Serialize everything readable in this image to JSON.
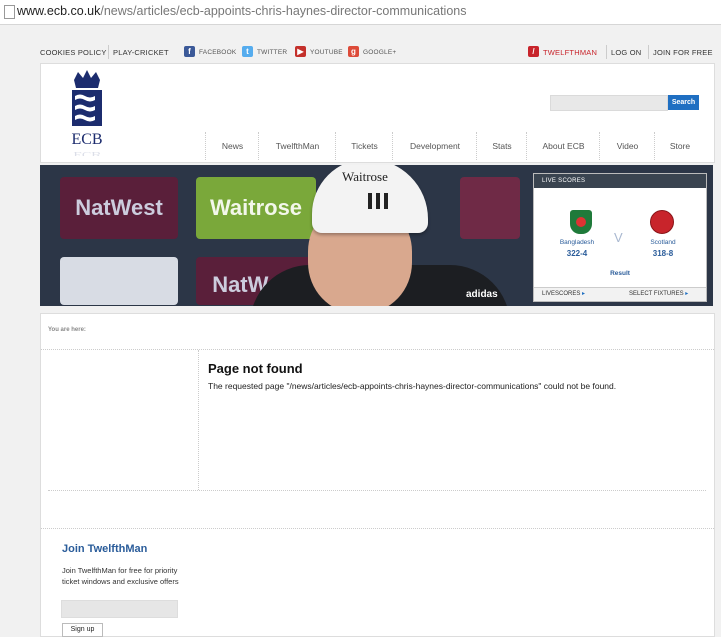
{
  "browser": {
    "url_domain": "www.ecb.co.uk",
    "url_path": "/news/articles/ecb-appoints-chris-haynes-director-communications"
  },
  "top_bar": {
    "cookies_policy": "COOKIES POLICY",
    "play_cricket": "PLAY-CRICKET",
    "facebook": "FACEBOOK",
    "twitter": "TWITTER",
    "youtube": "YOUTUBE",
    "googleplus": "GOOGLE+",
    "twelfthman": "TWELFTHMAN",
    "log_on": "LOG ON",
    "join": "JOIN FOR FREE"
  },
  "header": {
    "logo_text": "ECB",
    "search_button": "Search"
  },
  "nav": [
    "News",
    "TwelfthMan",
    "Tickets",
    "Development",
    "Stats",
    "About ECB",
    "Video",
    "Store"
  ],
  "banner": {
    "cap_brand": "Waitrose",
    "boards": [
      "NatWest",
      "Waitrose",
      "NatWest"
    ],
    "kit_brand": "adidas"
  },
  "live_scores": {
    "title": "LIVE SCORES",
    "vs": "V",
    "team1": {
      "name": "Bangladesh",
      "score": "322-4"
    },
    "team2": {
      "name": "Scotland",
      "score": "318-8"
    },
    "result": "Result",
    "livescores_link": "LIVESCORES",
    "fixtures_link": "SELECT FIXTURES"
  },
  "breadcrumb": "You are here:",
  "error": {
    "title": "Page not found",
    "message": "The requested page \"/news/articles/ecb-appoints-chris-haynes-director-communications\" could not be found."
  },
  "join_panel": {
    "title": "Join TwelfthMan",
    "text": "Join TwelfthMan for free for priority ticket windows and exclusive offers",
    "signup": "Sign up"
  },
  "colors": {
    "accent_blue": "#1f6fc2",
    "ecb_navy": "#1c2c6e",
    "twelfthman_red": "#c8242b",
    "link_blue": "#2a5c9a"
  }
}
